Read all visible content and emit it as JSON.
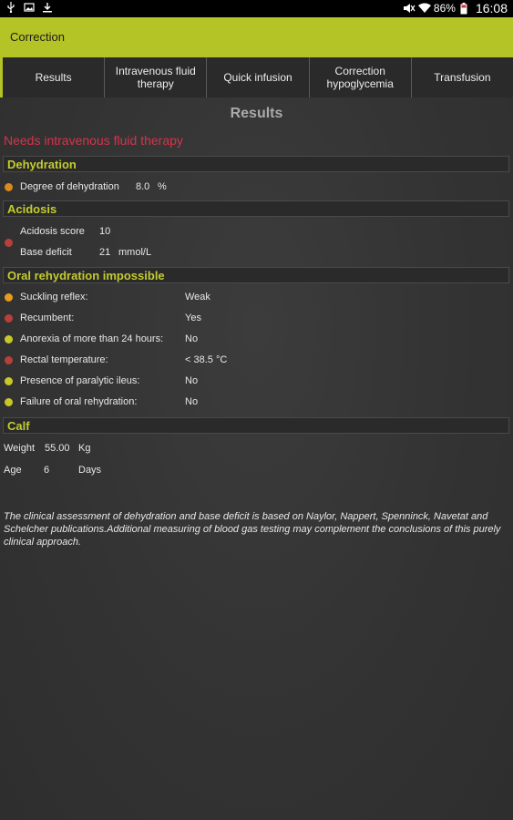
{
  "status_bar": {
    "battery": "86%",
    "time": "16:08"
  },
  "action_bar": {
    "title": "Correction"
  },
  "tabs": [
    {
      "label": "Results"
    },
    {
      "label": "Intravenous fluid therapy"
    },
    {
      "label": "Quick infusion"
    },
    {
      "label": "Correction hypoglycemia"
    },
    {
      "label": "Transfusion"
    }
  ],
  "page_title": "Results",
  "alert": "Needs intravenous fluid therapy",
  "dehydration": {
    "header": "Dehydration",
    "label": "Degree of dehydration",
    "value": "8.0",
    "unit": "%",
    "dot_color": "#d98a1e"
  },
  "acidosis": {
    "header": "Acidosis",
    "score_label": "Acidosis score",
    "score_value": "10",
    "deficit_label": "Base deficit",
    "deficit_value": "21",
    "deficit_unit": "mmol/L",
    "dot_color": "#b8403a"
  },
  "oral": {
    "header": "Oral rehydration impossible",
    "rows": [
      {
        "label": "Suckling reflex:",
        "value": "Weak",
        "color": "#e79a1e"
      },
      {
        "label": "Recumbent:",
        "value": "Yes",
        "color": "#b8403a"
      },
      {
        "label": "Anorexia of more than 24 hours:",
        "value": "No",
        "color": "#c6c82a"
      },
      {
        "label": "Rectal temperature:",
        "value": "< 38.5 °C",
        "color": "#b8403a"
      },
      {
        "label": "Presence of paralytic ileus:",
        "value": "No",
        "color": "#c6c82a"
      },
      {
        "label": "Failure of oral rehydration:",
        "value": "No",
        "color": "#c6c82a"
      }
    ]
  },
  "calf": {
    "header": "Calf",
    "weight_label": "Weight",
    "weight_value": "55.00",
    "weight_unit": "Kg",
    "age_label": "Age",
    "age_value": "6",
    "age_unit": "Days"
  },
  "footnote": "The clinical assessment of dehydration and base deficit is based on Naylor, Nappert, Spenninck, Navetat and Schelcher publications.Additional measuring of blood gas testing may complement the conclusions of this purely clinical approach.",
  "colors": {
    "accent": "#b4c325",
    "alert": "#d7334a",
    "section_text": "#c4cc2e"
  }
}
